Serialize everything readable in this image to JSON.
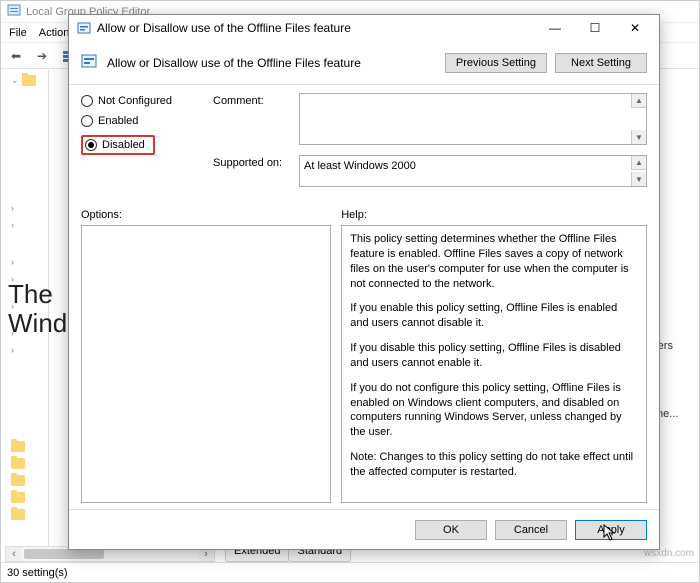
{
  "parent": {
    "title": "Local Group Policy Editor",
    "menu": {
      "file": "File",
      "action": "Action"
    },
    "status": "30 setting(s)",
    "tabs": {
      "extended": "Extended",
      "standard": "Standard"
    },
    "right": {
      "olders": "olders",
      "signe": "signe..."
    }
  },
  "dialog": {
    "title": "Allow or Disallow use of the Offline Files feature",
    "header": {
      "title": "Allow or Disallow use of the Offline Files feature",
      "previous": "Previous Setting",
      "next": "Next Setting"
    },
    "radios": {
      "notConfigured": "Not Configured",
      "enabled": "Enabled",
      "disabled": "Disabled"
    },
    "labels": {
      "comment": "Comment:",
      "supportedOn": "Supported on:",
      "options": "Options:",
      "help": "Help:"
    },
    "supportedOn": "At least Windows 2000",
    "help": {
      "p1": "This policy setting determines whether the Offline Files feature is enabled. Offline Files saves a copy of network files on the user's computer for use when the computer is not connected to the network.",
      "p2": "If you enable this policy setting, Offline Files is enabled and users cannot disable it.",
      "p3": "If you disable this policy setting, Offline Files is disabled and users cannot enable it.",
      "p4": "If you do not configure this policy setting, Offline Files is enabled on Windows client computers, and disabled on computers running Windows Server, unless changed by the user.",
      "p5": "Note: Changes to this policy setting do not take effect until the affected computer is restarted."
    },
    "buttons": {
      "ok": "OK",
      "cancel": "Cancel",
      "apply": "Apply"
    }
  },
  "watermark": {
    "line1": "The",
    "line2": "WindowsClub",
    "url": "wsxdn.com"
  }
}
